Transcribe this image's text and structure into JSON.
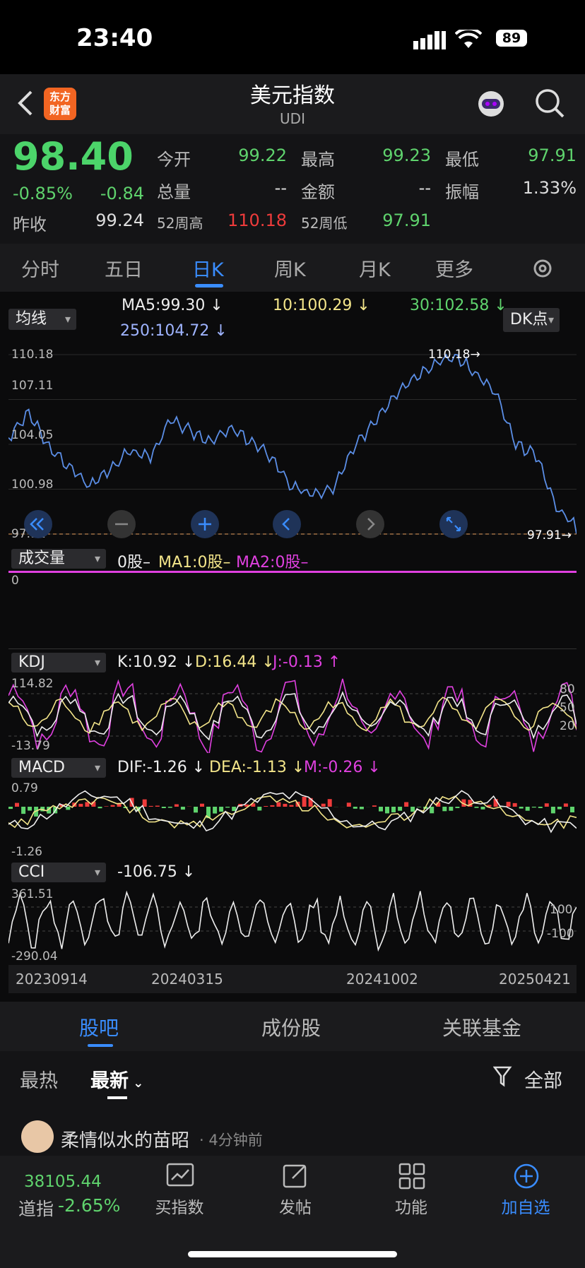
{
  "status": {
    "time": "23:40",
    "battery": "89"
  },
  "header": {
    "title": "美元指数",
    "subtitle": "UDI",
    "logo": "东方\n财富"
  },
  "quote": {
    "price": "98.40",
    "change_pct": "-0.85%",
    "change": "-0.84",
    "prev_close_label": "昨收",
    "prev_close": "99.24",
    "open_label": "今开",
    "open": "99.22",
    "high_label": "最高",
    "high": "99.23",
    "low_label": "最低",
    "low": "97.91",
    "volume_label": "总量",
    "volume": "--",
    "amount_label": "金额",
    "amount": "--",
    "amplitude_label": "振幅",
    "amplitude": "1.33%",
    "w52h_label": "52周高",
    "w52h": "110.18",
    "w52l_label": "52周低",
    "w52l": "97.91"
  },
  "tabs": [
    "分时",
    "五日",
    "日K",
    "周K",
    "月K",
    "更多"
  ],
  "ma": {
    "selector": "均线",
    "ma5": "MA5:99.30",
    "ma10": "10:100.29",
    "ma30": "30:102.58",
    "ma250": "250:104.72",
    "dk": "DK点"
  },
  "price_axis": [
    "110.18",
    "107.11",
    "104.05",
    "100.98",
    "97.91"
  ],
  "price_marks": {
    "high": "110.18",
    "low": "97.91"
  },
  "volume": {
    "selector": "成交量",
    "v": "0股",
    "ma1": "MA1:0股",
    "ma2": "MA2:0股",
    "axis": "0"
  },
  "kdj": {
    "selector": "KDJ",
    "k": "K:10.92",
    "d": "D:16.44",
    "j": "J:-0.13",
    "top": "114.82",
    "bottom": "-13.79",
    "r80": "80",
    "r50": "50",
    "r20": "20"
  },
  "macd": {
    "selector": "MACD",
    "dif": "DIF:-1.26",
    "dea": "DEA:-1.13",
    "m": "M:-0.26",
    "top": "0.79",
    "bottom": "-1.26"
  },
  "cci": {
    "selector": "CCI",
    "v": "-106.75",
    "top": "361.51",
    "bottom": "-290.04",
    "p100": "100",
    "m100": "-100"
  },
  "dates": [
    "20230914",
    "20240315",
    "20241002",
    "20250421"
  ],
  "subtabs": [
    "股吧",
    "成份股",
    "关联基金"
  ],
  "feed": {
    "tabs": [
      "最热",
      "最新"
    ],
    "filter": "全部",
    "post_user": "柔情似水的苗昭",
    "post_time": "· 4分钟前"
  },
  "bottom": {
    "index_value": "38105.44",
    "index_name": "道指",
    "index_change": "-2.65%",
    "nav": [
      "买指数",
      "发帖",
      "功能",
      "加自选"
    ]
  },
  "colors": {
    "green": "#5fd36d",
    "red": "#ee3b3b",
    "blue": "#3a8dff",
    "yellow": "#f3e58a",
    "magenta": "#e040e0"
  },
  "chart_data": {
    "type": "line",
    "title": "",
    "x": [
      "20230914",
      "20240315",
      "20241002",
      "20250421"
    ],
    "series": [
      {
        "name": "",
        "values": [
          104.5,
          106.2,
          103.8,
          102.5,
          101.2,
          102.4,
          103.6,
          103.2,
          105.7,
          104.9,
          104.3,
          105.1,
          104.2,
          103.1,
          101.1,
          100.6,
          101.0,
          103.7,
          105.6,
          107.4,
          108.7,
          109.5,
          110.18,
          108.9,
          107.6,
          104.0,
          103.3,
          99.8,
          98.4
        ]
      }
    ],
    "ylim": [
      97.91,
      110.18
    ]
  }
}
